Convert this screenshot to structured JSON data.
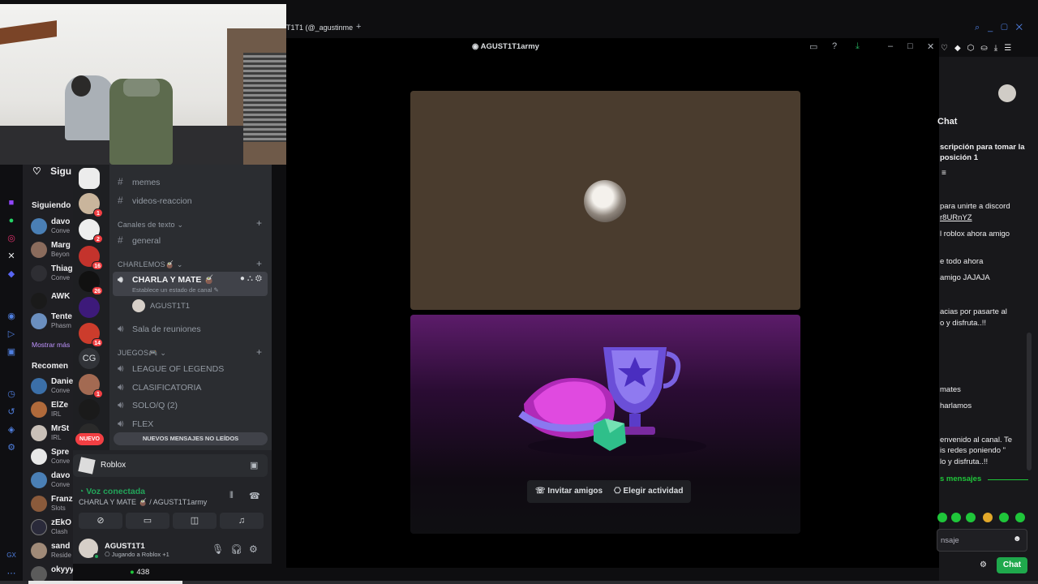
{
  "window": {
    "tab_title": "T1T1 (@_agustinme",
    "voice_title": "AGUST1T1army"
  },
  "twitch_sidebar": {
    "follow_heading_partial": "Sigu",
    "following_label": "Siguiendo",
    "show_more": "Mostrar más",
    "recommended_label": "Recomen",
    "following": [
      {
        "name": "davo",
        "sub": "Conve"
      },
      {
        "name": "Marg",
        "sub": "Beyon"
      },
      {
        "name": "Thiag",
        "sub": "Conve"
      },
      {
        "name": "AWK",
        "sub": ""
      },
      {
        "name": "Tente",
        "sub": "Phasm"
      }
    ],
    "recommended": [
      {
        "name": "Danie",
        "sub": "Conve"
      },
      {
        "name": "ElZe",
        "sub": "IRL"
      },
      {
        "name": "MrSt",
        "sub": "IRL"
      },
      {
        "name": "Spre",
        "sub": "Conve"
      },
      {
        "name": "davo",
        "sub": "Conve"
      },
      {
        "name": "Franz",
        "sub": "Slots"
      },
      {
        "name": "zEkO",
        "sub": "Clash"
      },
      {
        "name": "sand",
        "sub": "Reside"
      },
      {
        "name": "okyyy",
        "sub": ""
      }
    ],
    "viewer_count": "438"
  },
  "servers": {
    "badges": [
      "1",
      "2",
      "16",
      "26",
      "14",
      "1"
    ],
    "cg_label": "CG",
    "nuevo_label": "NUEVO"
  },
  "channels": {
    "memes": "memes",
    "videos": "videos-reaccion",
    "cat_text": "Canales de texto",
    "general": "general",
    "cat_charlemos": "CHARLEMOS🧉",
    "active_channel": "CHARLA Y MATE 🧉",
    "active_status": "Establece un estado de canal",
    "voice_member": "AGUST1T1",
    "sala": "Sala de reuniones",
    "cat_juegos": "JUEGOS🎮",
    "lol": "LEAGUE OF LEGENDS",
    "clasif": "CLASIFICATORIA",
    "soloq": "SOLO/Q (2)",
    "flex": "FLEX",
    "unread_banner": "NUEVOS MENSAJES NO LEÍDOS"
  },
  "voice_panel": {
    "activity": "Roblox",
    "status": "Voz conectada",
    "location": "CHARLA Y MATE 🧉 / AGUST1T1army",
    "user": "AGUST1T1",
    "user_status": "Jugando a Roblox +1"
  },
  "stage": {
    "invite_btn": "Invitar amigos",
    "activity_btn": "Elegir actividad"
  },
  "chat": {
    "heading": "Chat",
    "messages": [
      "scripción para tomar la",
      "posición 1",
      "para unirte a discord",
      "r8URnYZ",
      "l roblox ahora amigo",
      "e todo ahora",
      "amigo JAJAJA",
      "acias por pasarte al",
      "o y disfruta..!!",
      "mates",
      "harlamos",
      "envenido al canal. Te",
      "is redes poniendo \"",
      "lo y disfruta..!!"
    ],
    "new_messages": "s mensajes",
    "input_placeholder": "nsaje",
    "send_label": "Chat"
  }
}
